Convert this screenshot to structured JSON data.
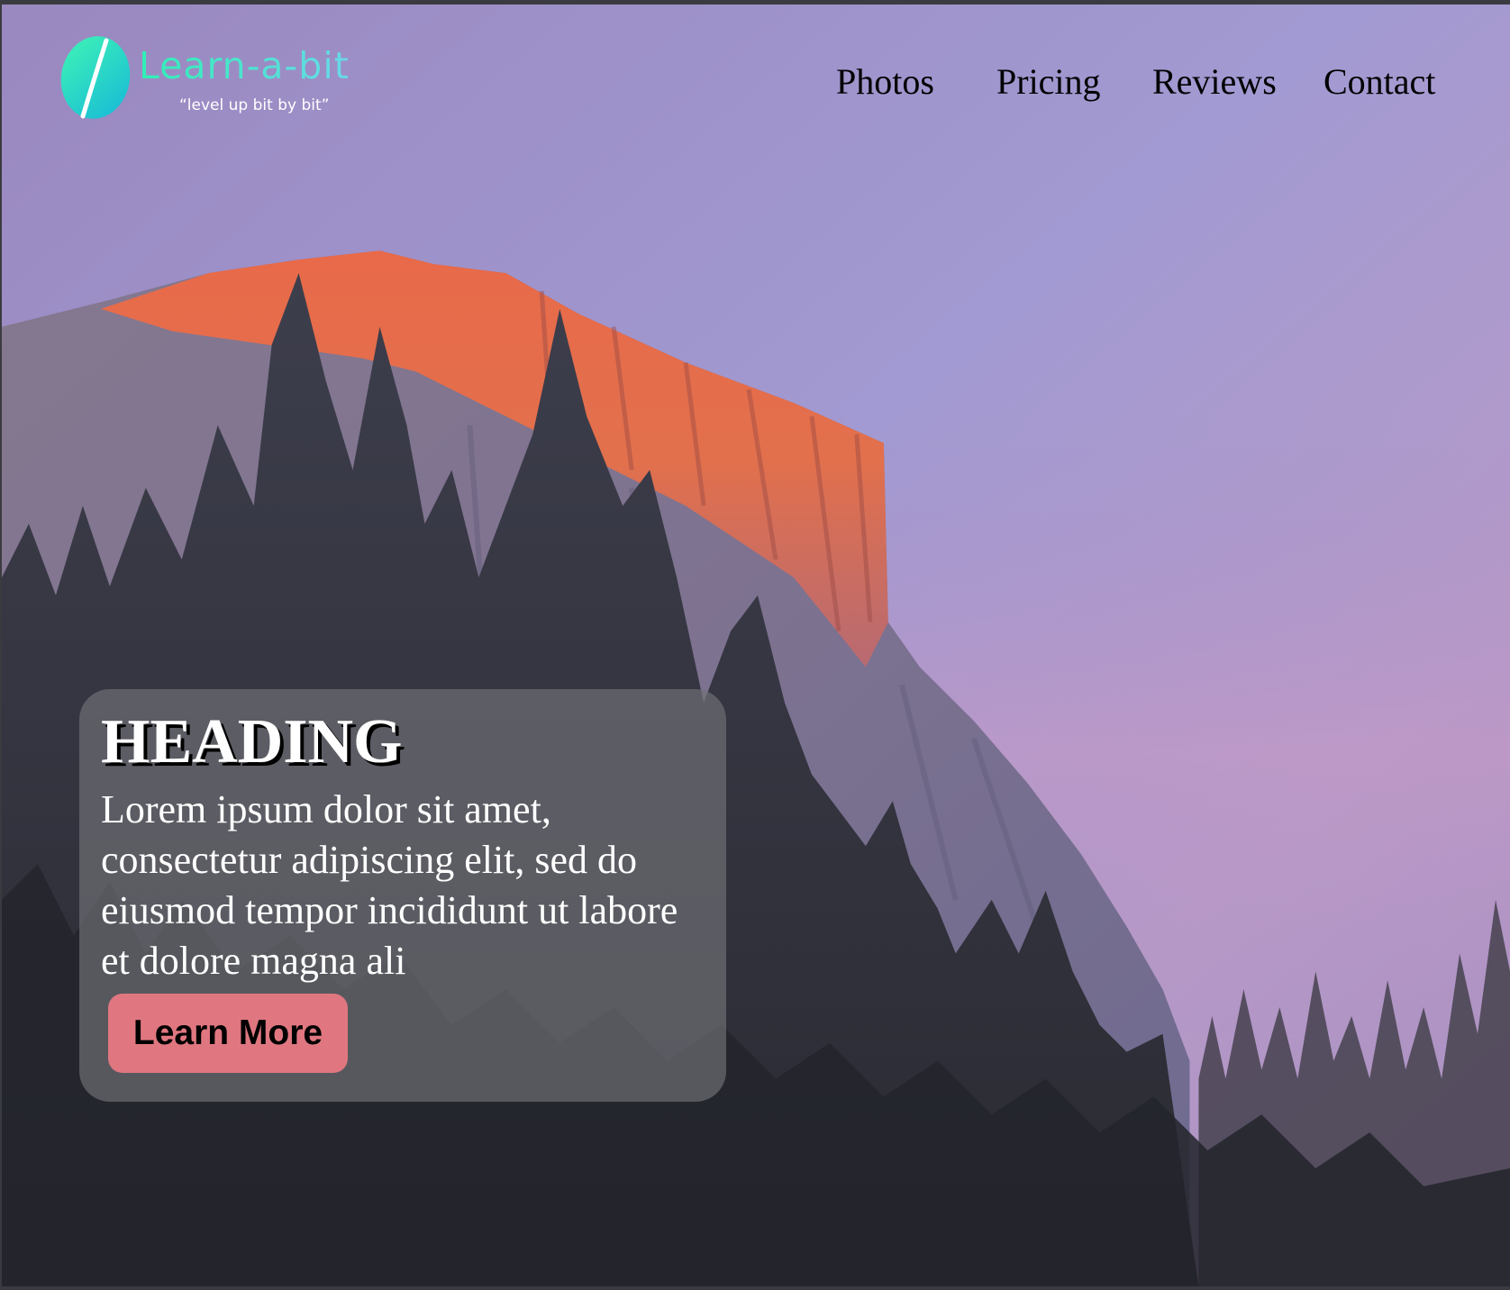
{
  "logo": {
    "name": "Learn-a-bit",
    "tagline": "“level up bit by bit”"
  },
  "nav": {
    "items": [
      "Photos",
      "Pricing",
      "Reviews",
      "Contact"
    ]
  },
  "hero": {
    "heading": "HEADING",
    "body": "Lorem ipsum dolor sit amet, consectetur adipiscing elit, sed do eiusmod tempor incididunt ut labore et dolore magna ali",
    "button_label": "Learn More"
  },
  "colors": {
    "logo_accent": "#2ee5bd",
    "button_bg": "#e07780",
    "card_bg": "rgba(112,112,118,0.68)"
  },
  "icons": {
    "logo_mark": "leaf-icon"
  }
}
